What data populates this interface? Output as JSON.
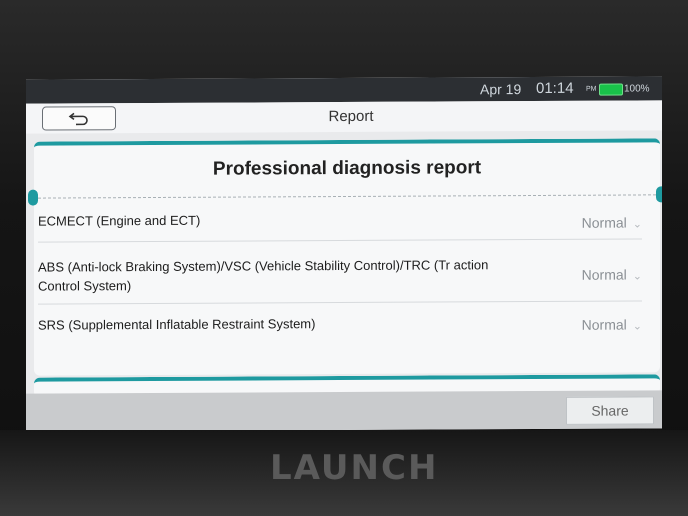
{
  "device": {
    "brand": "LAUNCH"
  },
  "status": {
    "date": "Apr 19",
    "time": "01:14",
    "ampm": "PM",
    "battery": "100%",
    "battery_level": 1.0
  },
  "header": {
    "title": "Report",
    "back_icon": "back-arrow-icon"
  },
  "report": {
    "title": "Professional diagnosis report",
    "rows": [
      {
        "label": "ECMECT (Engine and ECT)",
        "status": "Normal"
      },
      {
        "label": "ABS (Anti-lock Braking System)/VSC (Vehicle Stability Control)/TRC (Tr action Control System)",
        "status": "Normal"
      },
      {
        "label": "SRS (Supplemental Inflatable Restraint System)",
        "status": "Normal"
      }
    ]
  },
  "footer": {
    "share_label": "Share"
  },
  "colors": {
    "accent": "#1e9aa0",
    "battery": "#19c24a"
  }
}
